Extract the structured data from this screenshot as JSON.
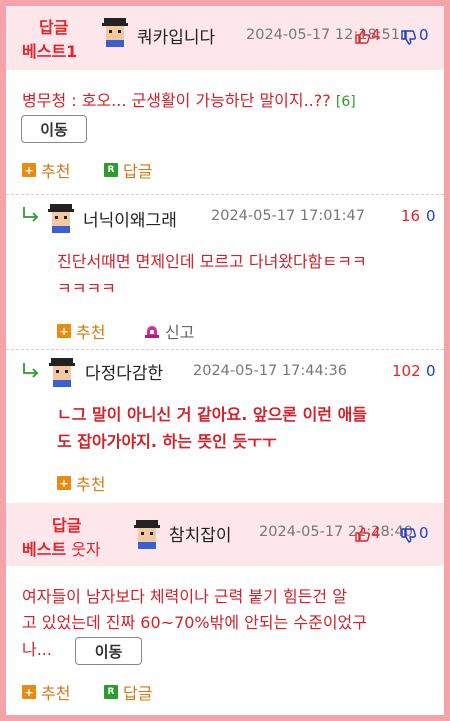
{
  "comments": [
    {
      "badge_line1": "답글",
      "badge_line2": "베스트1",
      "nickname": "쿼카입니다",
      "date": "2024-05-17 12:18:51",
      "likes": "4",
      "dislikes": "0",
      "content": "병무청 : 호오... 군생활이 가능하단 말이지..??",
      "reply_count": "[6]",
      "move_label": "이동",
      "recommend_label": "추천",
      "reply_label": "답글"
    },
    {
      "nickname": "너닉이왜그래",
      "date": "2024-05-17 17:01:47",
      "likes": "16",
      "dislikes": "0",
      "content_line1": "진단서때면 면제인데 모르고 다녀왔다함ㅌㅋㅋ",
      "content_line2": "ㅋㅋㅋㅋ",
      "recommend_label": "추천",
      "report_label": "신고"
    },
    {
      "nickname": "다정다감한",
      "date": "2024-05-17 17:44:36",
      "likes": "102",
      "dislikes": "0",
      "content_line1": "ㄴ그 말이 아니신 거 같아요. 앞으론 이런 애들",
      "content_line2": "도 잡아가야지. 하는 뜻인 듯ㅜㅜ",
      "recommend_label": "추천"
    },
    {
      "badge_line1": "답글",
      "badge_line2": "베스트",
      "badge_extra": "웃자",
      "nickname": "참치잡이",
      "date": "2024-05-17 21:28:40",
      "likes": "4",
      "dislikes": "0",
      "content_line1": "여자들이 남자보다 체력이나 근력 붙기 힘든건 알",
      "content_line2": "고 있었는데 진짜 60~70%밖에 안되는 수준이었구",
      "content_line3": "나...",
      "move_label": "이동",
      "recommend_label": "추천",
      "reply_label": "답글"
    }
  ],
  "icons": {
    "recommend": "plus-square-icon",
    "reply": "r-square-icon",
    "report": "siren-icon",
    "like": "thumbs-up-icon",
    "dislike": "thumbs-down-icon",
    "reply_arrow": "reply-arrow-icon",
    "avatar": "pixel-avatar-icon"
  },
  "colors": {
    "border": "#f5a3a8",
    "best_bg": "#fde7ea",
    "content_red": "#d3202a",
    "count_blue": "#1a3fc8",
    "action_orange": "#d27a14",
    "reply_green": "#2a9d2a"
  }
}
